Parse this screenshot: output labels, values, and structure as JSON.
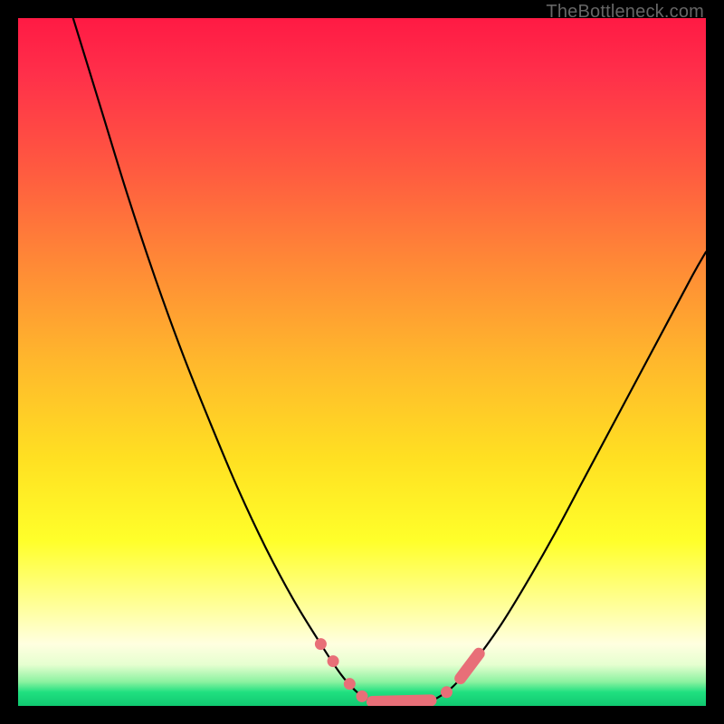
{
  "attribution": "TheBottleneck.com",
  "chart_data": {
    "type": "line",
    "title": "",
    "xlabel": "",
    "ylabel": "",
    "xlim": [
      0,
      100
    ],
    "ylim": [
      0,
      100
    ],
    "background_gradient": {
      "top": "#ff1a44",
      "mid1": "#ff8a36",
      "mid2": "#ffe022",
      "mid3": "#ffffe0",
      "bottom": "#10c870"
    },
    "series": [
      {
        "name": "left-curve",
        "x": [
          8,
          12,
          16,
          20,
          24,
          28,
          32,
          36,
          40,
          44,
          47,
          49.5,
          51.5
        ],
        "y": [
          100,
          87,
          74,
          62,
          51,
          41,
          31.5,
          23,
          15.5,
          9,
          4.5,
          1.8,
          0.6
        ]
      },
      {
        "name": "valley-floor",
        "x": [
          51.5,
          53,
          55,
          57,
          59,
          60.5
        ],
        "y": [
          0.6,
          0.2,
          0.1,
          0.12,
          0.35,
          0.9
        ]
      },
      {
        "name": "right-curve",
        "x": [
          60.5,
          63,
          66,
          70,
          74,
          78,
          82,
          86,
          90,
          94,
          98,
          100
        ],
        "y": [
          0.9,
          2.6,
          6,
          11.5,
          18,
          25,
          32.5,
          40,
          47.5,
          55,
          62.5,
          66
        ]
      }
    ],
    "markers": [
      {
        "name": "left-bead-1",
        "x": 44.0,
        "y": 9.0
      },
      {
        "name": "left-bead-2",
        "x": 45.8,
        "y": 6.5
      },
      {
        "name": "left-bead-3",
        "x": 48.2,
        "y": 3.2
      },
      {
        "name": "left-bead-4",
        "x": 50.0,
        "y": 1.4
      },
      {
        "name": "floor-segment",
        "segment": {
          "x1": 51.5,
          "y1": 0.6,
          "x2": 60.0,
          "y2": 0.8
        }
      },
      {
        "name": "right-bead-1",
        "x": 62.3,
        "y": 2.0
      },
      {
        "name": "right-segment",
        "segment": {
          "x1": 64.3,
          "y1": 4.0,
          "x2": 67.0,
          "y2": 7.6
        }
      }
    ]
  }
}
